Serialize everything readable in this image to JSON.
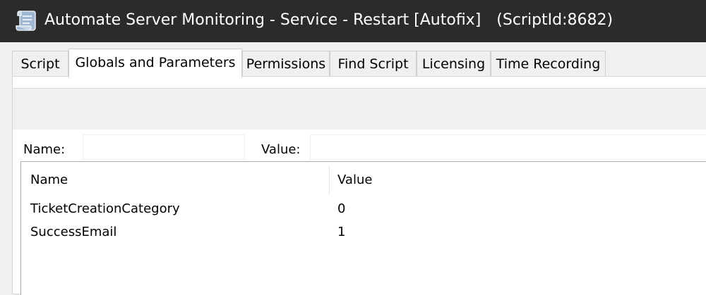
{
  "window": {
    "title": "Automate Server Monitoring - Service - Restart [Autofix]",
    "script_id": "(ScriptId:8682)",
    "icon": "script-scroll-icon"
  },
  "tabs": [
    {
      "label": "Script",
      "active": false
    },
    {
      "label": "Globals and Parameters",
      "active": true
    },
    {
      "label": "Permissions",
      "active": false
    },
    {
      "label": "Find Script",
      "active": false
    },
    {
      "label": "Licensing",
      "active": false
    },
    {
      "label": "Time Recording",
      "active": false
    }
  ],
  "editor": {
    "name_label": "Name:",
    "name_value": "",
    "value_label": "Value:",
    "value_value": ""
  },
  "table": {
    "columns": [
      "Name",
      "Value"
    ],
    "rows": [
      {
        "name": "TicketCreationCategory",
        "value": "0"
      },
      {
        "name": "SuccessEmail",
        "value": "1"
      }
    ]
  }
}
